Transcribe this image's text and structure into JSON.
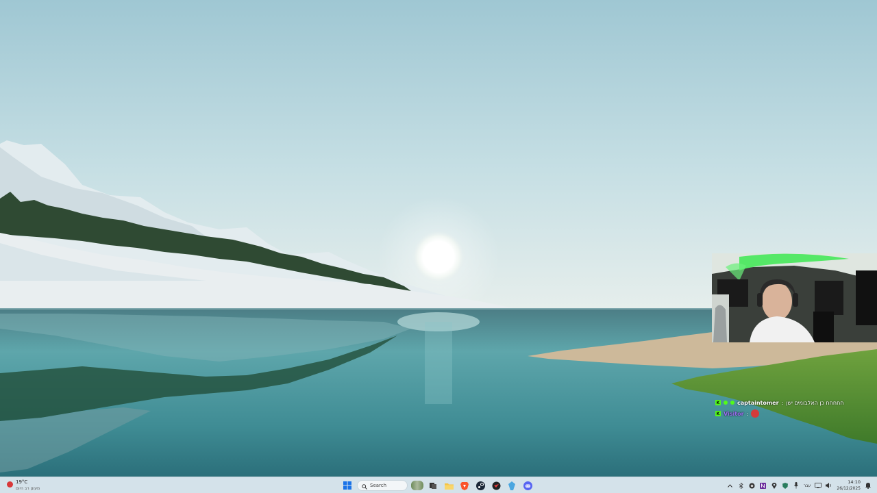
{
  "chat": {
    "messages": [
      {
        "badge": "K",
        "username": "captaintomer",
        "separator": ":",
        "text": "חחחחח כן האלבומים ישן"
      },
      {
        "badge": "K",
        "username": "Visitor",
        "separator": ":",
        "emote": "red-emote"
      }
    ]
  },
  "taskbar": {
    "weather": {
      "temp": "19°C",
      "condition": "מעונן רב היום",
      "icon": "weather-alert-icon"
    },
    "search_placeholder": "Search",
    "apps": [
      "windows-start-icon",
      "search-icon",
      "widgets-highlight",
      "task-view-icon",
      "file-explorer-icon",
      "brave-browser-icon",
      "steam-icon",
      "chat-app-icon",
      "copilot-icon",
      "discord-icon"
    ],
    "tray": {
      "language": "עבר",
      "time": "14:10",
      "date": "26/12/2025"
    }
  }
}
